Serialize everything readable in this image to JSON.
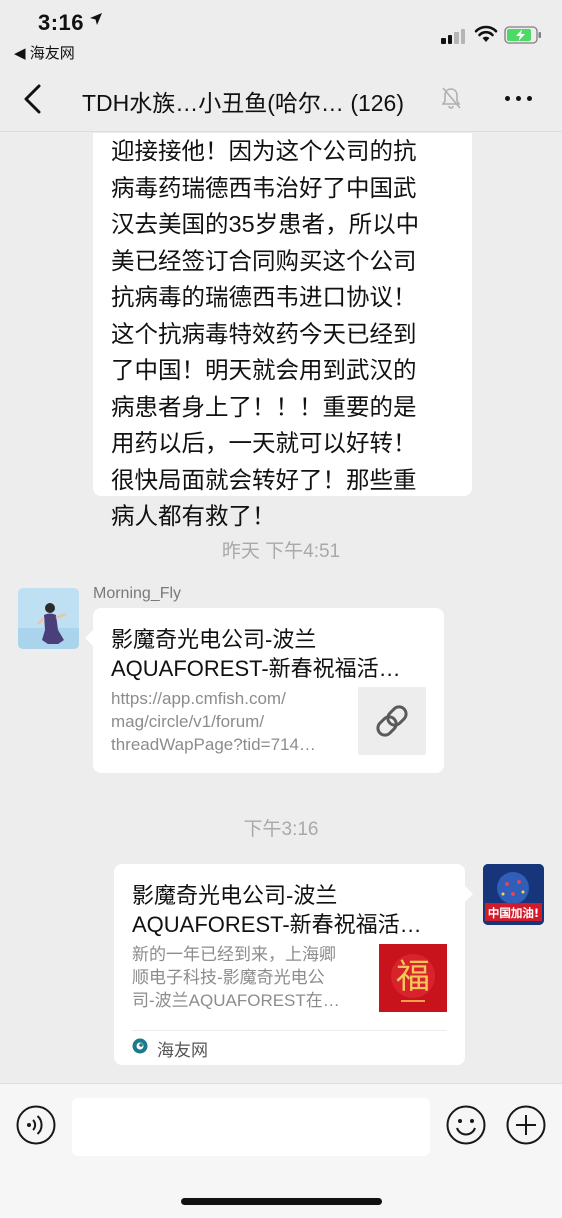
{
  "status_bar": {
    "time": "3:16",
    "back_app": "◀ 海友网"
  },
  "nav": {
    "title": "TDH水族…小丑鱼(哈尔… (126)"
  },
  "messages": {
    "text_message": "迎接接他！因为这个公司的抗\n病毒药瑞德西韦治好了中国武\n汉去美国的35岁患者，所以中\n美已经签订合同购买这个公司\n抗病毒的瑞德西韦进口协议！\n这个抗病毒特效药今天已经到\n了中国！明天就会用到武汉的\n病患者身上了！！！重要的是\n用药以后，一天就可以好转！\n很快局面就会转好了！那些重\n病人都有救了！",
    "timestamp_1": "昨天 下午4:51",
    "sender_name": "Morning_Fly",
    "link_card": {
      "title_line1": "影魔奇光电公司-波兰",
      "title_line2": "AQUAFOREST-新春祝福活…",
      "url_line1": "https://app.cmfish.com/",
      "url_line2": "mag/circle/v1/forum/",
      "url_line3": "threadWapPage?tid=714…"
    },
    "timestamp_2": "下午3:16",
    "article_card": {
      "title_line1": "影魔奇光电公司-波兰",
      "title_line2": "AQUAFOREST-新春祝福活…",
      "desc_line1": "新的一年已经到来，上海卿",
      "desc_line2": "顺电子科技-影魔奇光电公",
      "desc_line3": "司-波兰AQUAFOREST在…",
      "source": "海友网",
      "thumb_text": "福"
    },
    "my_avatar_text": "中国加油!"
  },
  "input": {
    "value": "",
    "placeholder": ""
  },
  "colors": {
    "background": "#ededed",
    "bubble": "#ffffff",
    "timestamp": "#a9a9a9",
    "source_teal": "#1b7a8c",
    "thumb_red": "#c8121c"
  },
  "icons": {
    "back": "chevron-left-icon",
    "mute": "bell-slash-icon",
    "more": "more-dots-icon",
    "link": "link-icon",
    "voice": "voice-icon",
    "emoji": "emoji-icon",
    "plus": "plus-icon"
  }
}
